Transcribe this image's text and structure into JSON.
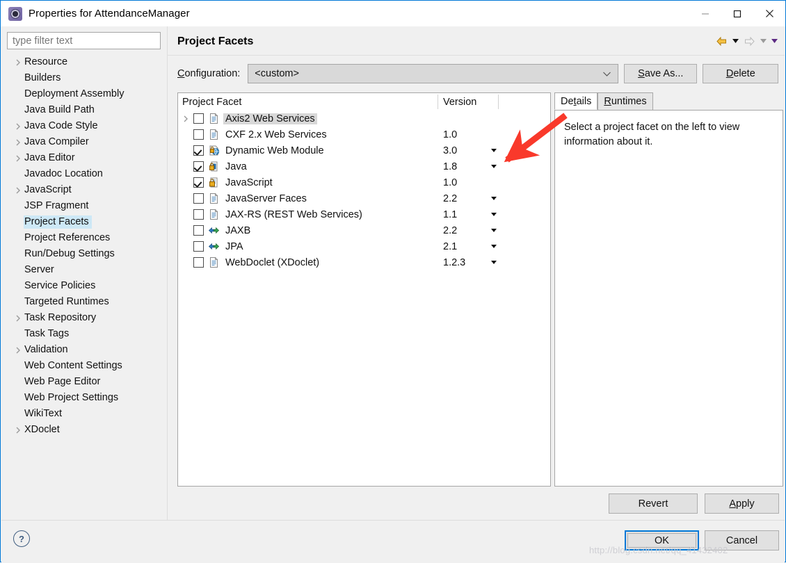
{
  "window": {
    "title": "Properties for AttendanceManager",
    "icon": "eclipse-properties-icon",
    "minimize_label": "Minimize",
    "maximize_label": "Maximize",
    "close_label": "Close"
  },
  "sidebar": {
    "filter": {
      "placeholder": "type filter text",
      "value": ""
    },
    "items": [
      {
        "label": "Resource",
        "expandable": true,
        "selected": false
      },
      {
        "label": "Builders",
        "expandable": false,
        "selected": false
      },
      {
        "label": "Deployment Assembly",
        "expandable": false,
        "selected": false
      },
      {
        "label": "Java Build Path",
        "expandable": false,
        "selected": false
      },
      {
        "label": "Java Code Style",
        "expandable": true,
        "selected": false
      },
      {
        "label": "Java Compiler",
        "expandable": true,
        "selected": false
      },
      {
        "label": "Java Editor",
        "expandable": true,
        "selected": false
      },
      {
        "label": "Javadoc Location",
        "expandable": false,
        "selected": false
      },
      {
        "label": "JavaScript",
        "expandable": true,
        "selected": false
      },
      {
        "label": "JSP Fragment",
        "expandable": false,
        "selected": false
      },
      {
        "label": "Project Facets",
        "expandable": false,
        "selected": true
      },
      {
        "label": "Project References",
        "expandable": false,
        "selected": false
      },
      {
        "label": "Run/Debug Settings",
        "expandable": false,
        "selected": false
      },
      {
        "label": "Server",
        "expandable": false,
        "selected": false
      },
      {
        "label": "Service Policies",
        "expandable": false,
        "selected": false
      },
      {
        "label": "Targeted Runtimes",
        "expandable": false,
        "selected": false
      },
      {
        "label": "Task Repository",
        "expandable": true,
        "selected": false
      },
      {
        "label": "Task Tags",
        "expandable": false,
        "selected": false
      },
      {
        "label": "Validation",
        "expandable": true,
        "selected": false
      },
      {
        "label": "Web Content Settings",
        "expandable": false,
        "selected": false
      },
      {
        "label": "Web Page Editor",
        "expandable": false,
        "selected": false
      },
      {
        "label": "Web Project Settings",
        "expandable": false,
        "selected": false
      },
      {
        "label": "WikiText",
        "expandable": false,
        "selected": false
      },
      {
        "label": "XDoclet",
        "expandable": true,
        "selected": false
      }
    ]
  },
  "main": {
    "page_title": "Project Facets",
    "nav": {
      "back_icon": "back-arrow-icon",
      "back_menu_icon": "caret-down-icon",
      "forward_icon": "forward-arrow-icon",
      "forward_menu_icon": "caret-down-icon",
      "view_menu_icon": "caret-down-icon"
    },
    "configuration": {
      "label": "Configuration:",
      "value": "<custom>",
      "arrow_icon": "chevron-down-icon",
      "save_as_label": "Save As...",
      "delete_label": "Delete"
    },
    "facet_table": {
      "columns": [
        "Project Facet",
        "Version"
      ],
      "rows": [
        {
          "name": "Axis2 Web Services",
          "version": "",
          "checked": false,
          "expandable": true,
          "highlighted": true,
          "icon": "document-icon",
          "has_version_dropdown": false
        },
        {
          "name": "CXF 2.x Web Services",
          "version": "1.0",
          "checked": false,
          "expandable": false,
          "highlighted": false,
          "icon": "document-icon",
          "has_version_dropdown": false
        },
        {
          "name": "Dynamic Web Module",
          "version": "3.0",
          "checked": true,
          "expandable": false,
          "highlighted": false,
          "icon": "web-module-icon",
          "has_version_dropdown": true
        },
        {
          "name": "Java",
          "version": "1.8",
          "checked": true,
          "expandable": false,
          "highlighted": false,
          "icon": "java-lock-icon",
          "has_version_dropdown": true
        },
        {
          "name": "JavaScript",
          "version": "1.0",
          "checked": true,
          "expandable": false,
          "highlighted": false,
          "icon": "script-lock-icon",
          "has_version_dropdown": false
        },
        {
          "name": "JavaServer Faces",
          "version": "2.2",
          "checked": false,
          "expandable": false,
          "highlighted": false,
          "icon": "document-icon",
          "has_version_dropdown": true
        },
        {
          "name": "JAX-RS (REST Web Services)",
          "version": "1.1",
          "checked": false,
          "expandable": false,
          "highlighted": false,
          "icon": "document-icon",
          "has_version_dropdown": true
        },
        {
          "name": "JAXB",
          "version": "2.2",
          "checked": false,
          "expandable": false,
          "highlighted": false,
          "icon": "binding-icon",
          "has_version_dropdown": true
        },
        {
          "name": "JPA",
          "version": "2.1",
          "checked": false,
          "expandable": false,
          "highlighted": false,
          "icon": "binding-icon",
          "has_version_dropdown": true
        },
        {
          "name": "WebDoclet (XDoclet)",
          "version": "1.2.3",
          "checked": false,
          "expandable": false,
          "highlighted": false,
          "icon": "document-icon",
          "has_version_dropdown": true
        }
      ]
    },
    "details_panel": {
      "tabs": [
        {
          "label": "Details",
          "active": true
        },
        {
          "label": "Runtimes",
          "active": false
        }
      ],
      "message": "Select a project facet on the left to view information about it."
    },
    "revert_label": "Revert",
    "apply_label": "Apply"
  },
  "footer": {
    "help_icon": "help-question-icon",
    "ok_label": "OK",
    "cancel_label": "Cancel"
  },
  "annotation": {
    "arrow_icon": "red-pointer-arrow",
    "color": "#f9392b"
  },
  "watermark": {
    "text": "http://blog.csdn.net/qq_41432402"
  },
  "colors": {
    "accent": "#0078d7",
    "selection": "#cde8f6",
    "row_highlight": "#d8d8d8",
    "window_bg": "#f0f0f0",
    "annotation_red": "#f9392b"
  }
}
